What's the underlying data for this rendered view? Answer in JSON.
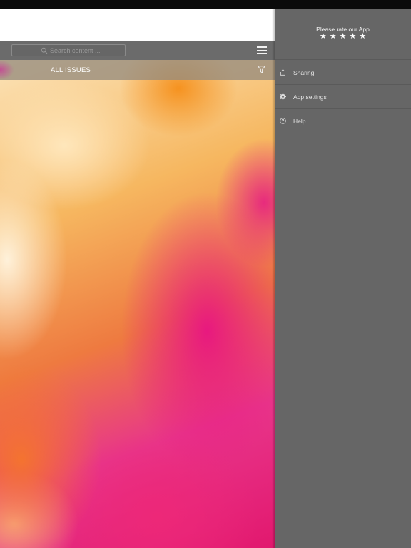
{
  "toolbar": {
    "search_placeholder": "Search content ..."
  },
  "filter_bar": {
    "label": "ALL ISSUES"
  },
  "side_menu": {
    "rate_label": "Please rate our App",
    "stars": [
      "★",
      "★",
      "★",
      "★",
      "★"
    ],
    "items": [
      {
        "label": "Sharing",
        "icon": "share-icon"
      },
      {
        "label": "App settings",
        "icon": "gear-icon"
      },
      {
        "label": "Help",
        "icon": "help-icon"
      }
    ]
  },
  "colors": {
    "toolbar": "#6b6b6b",
    "side_menu": "#666666",
    "accent_pink": "#e2186e",
    "accent_orange": "#f6b760"
  }
}
